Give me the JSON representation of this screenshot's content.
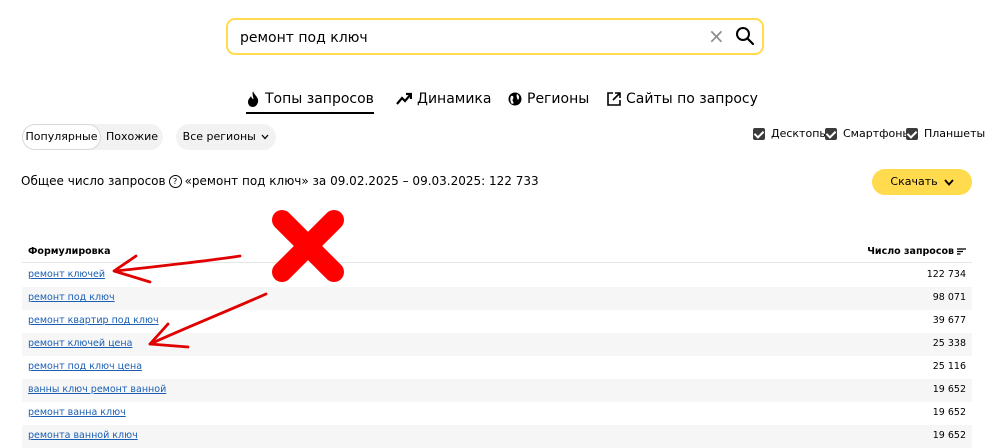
{
  "search": {
    "value": "ремонт под ключ",
    "clear_icon": "close-icon",
    "search_icon": "search-icon"
  },
  "tabs": [
    {
      "label": "Топы запросов",
      "icon": "flame-icon",
      "active": true
    },
    {
      "label": "Динамика",
      "icon": "trend-icon",
      "active": false
    },
    {
      "label": "Регионы",
      "icon": "globe-icon",
      "active": false
    },
    {
      "label": "Сайты по запросу",
      "icon": "external-link-icon",
      "active": false
    }
  ],
  "filters": {
    "segment": [
      "Популярные",
      "Похожие"
    ],
    "regions": "Все регионы",
    "devices": [
      "Десктопы",
      "Смартфоны",
      "Планшеты"
    ]
  },
  "summary": {
    "prefix": "Общее число запросов",
    "text": "«ремонт под ключ» за 09.02.2025 – 09.03.2025: 122 733"
  },
  "download": {
    "label": "Скачать"
  },
  "table": {
    "col1": "Формулировка",
    "col2": "Число запросов",
    "rows": [
      {
        "phrase": "ремонт ключей",
        "count": "122 734"
      },
      {
        "phrase": "ремонт под ключ",
        "count": "98 071"
      },
      {
        "phrase": "ремонт квартир под ключ",
        "count": "39 677"
      },
      {
        "phrase": "ремонт ключей цена",
        "count": "25 338"
      },
      {
        "phrase": "ремонт под ключ цена",
        "count": "25 116"
      },
      {
        "phrase": "ванны ключ ремонт ванной",
        "count": "19 652"
      },
      {
        "phrase": "ремонт ванна ключ",
        "count": "19 652"
      },
      {
        "phrase": "ремонта ванной ключ",
        "count": "19 652"
      }
    ]
  },
  "annotations": {
    "cross_color": "#ff0000",
    "arrow_color": "#e00000"
  }
}
